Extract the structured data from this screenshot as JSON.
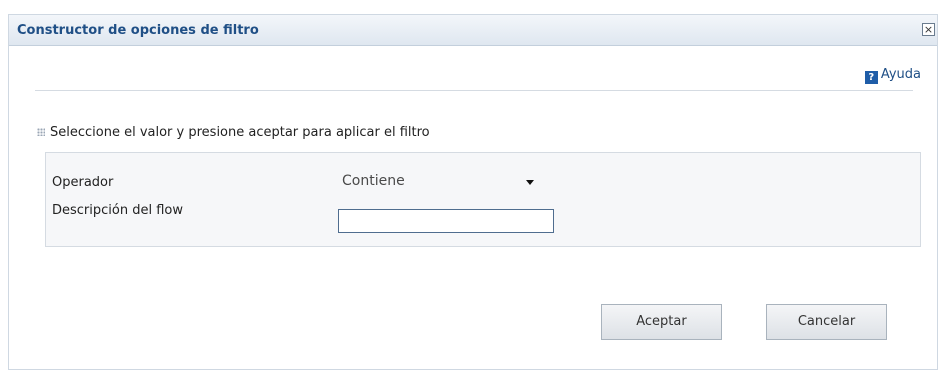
{
  "dialog": {
    "title": "Constructor de opciones de filtro",
    "close_symbol": "×",
    "help_label": "Ayuda",
    "help_icon_symbol": "?",
    "instruction": "Seleccione el valor y presione aceptar para aplicar el filtro",
    "operator_label": "Operador",
    "operator_value": "Contiene",
    "description_label": "Descripción del flow",
    "description_value": "",
    "accept_label": "Aceptar",
    "cancel_label": "Cancelar"
  },
  "icons": {
    "help": "help-icon",
    "close": "close-icon",
    "bullet": "dotted-bullet-icon",
    "dropdown": "chevron-down-icon"
  },
  "colors": {
    "title_text": "#1f4f86",
    "help_icon": "#1f5da8",
    "panel_bg": "#f6f7f9"
  }
}
